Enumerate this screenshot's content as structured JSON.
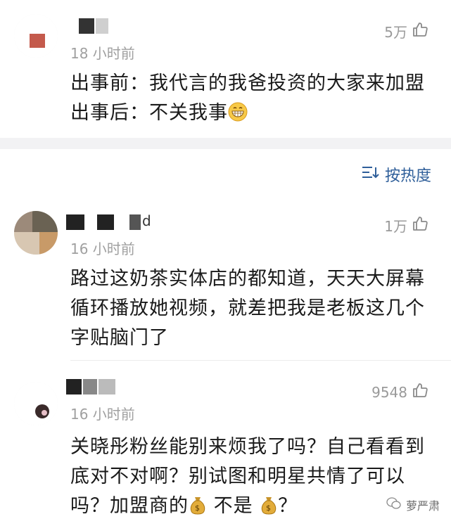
{
  "comments": [
    {
      "username": "  ",
      "time": "18 小时前",
      "likes": "5万",
      "text": [
        "出事前：我代言的我爸投资的大家来加盟",
        "出事后：不关我事"
      ]
    },
    {
      "username": "d",
      "time": "16 小时前",
      "likes": "1万",
      "text": [
        "路过这奶茶实体店的都知道，天天大屏幕",
        "循环播放她视频，就差把我是老板这几个",
        "字贴脑门了"
      ]
    },
    {
      "username": "",
      "time": "16 小时前",
      "likes": "9548",
      "text": [
        "关晓彤粉丝能别来烦我了吗？自己看看到",
        "底对不对啊？别试图和明星共情了可以",
        "吗？加盟商的",
        " 不是 ",
        "？"
      ]
    }
  ],
  "sort": {
    "label": "按热度"
  },
  "watermark": {
    "label": "萝严肃"
  },
  "colors": {
    "link": "#2f5f9a",
    "muted": "#a0a0a0",
    "band": "#f2f2f4"
  },
  "icons": {
    "like": "thumbs-up-icon",
    "sort": "sort-icon",
    "grin": "grinning-emoji-icon",
    "money": "money-bag-emoji-icon"
  }
}
